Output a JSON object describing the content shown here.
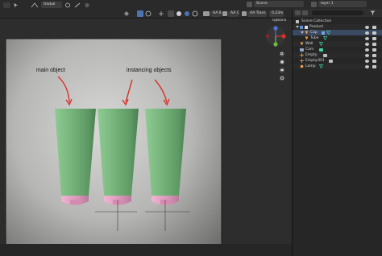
{
  "toolbar": {
    "mode_label": "Global",
    "scene_label": "Scene",
    "layer_label": "layer 1"
  },
  "viewport_header": {
    "aa_label": "AA 8",
    "aa_c_label": "AA C",
    "xray_label": "AA Trans",
    "zoom_label": "0.23m",
    "options_label": "Options"
  },
  "annotations": {
    "main_label": "main object",
    "instancing_label": "instancing objects"
  },
  "outliner": {
    "title": "Scene Collection",
    "items": [
      {
        "label": "Product",
        "depth": 1,
        "kind": "collection"
      },
      {
        "label": "Cap",
        "depth": 2,
        "kind": "mesh",
        "selected": true
      },
      {
        "label": "Tube",
        "depth": 2,
        "kind": "mesh"
      },
      {
        "label": "Wall",
        "depth": 1,
        "kind": "mesh"
      },
      {
        "label": "Cam",
        "depth": 1,
        "kind": "camera"
      },
      {
        "label": "Empty",
        "depth": 1,
        "kind": "empty"
      },
      {
        "label": "Empty.001",
        "depth": 1,
        "kind": "empty"
      },
      {
        "label": "Lamp",
        "depth": 1,
        "kind": "light"
      }
    ]
  },
  "colors": {
    "tube_green": "#7fbe83",
    "cap_pink": "#e7a3c6",
    "arrow_red": "#d8322a",
    "selection_blue": "#3b4a63"
  }
}
